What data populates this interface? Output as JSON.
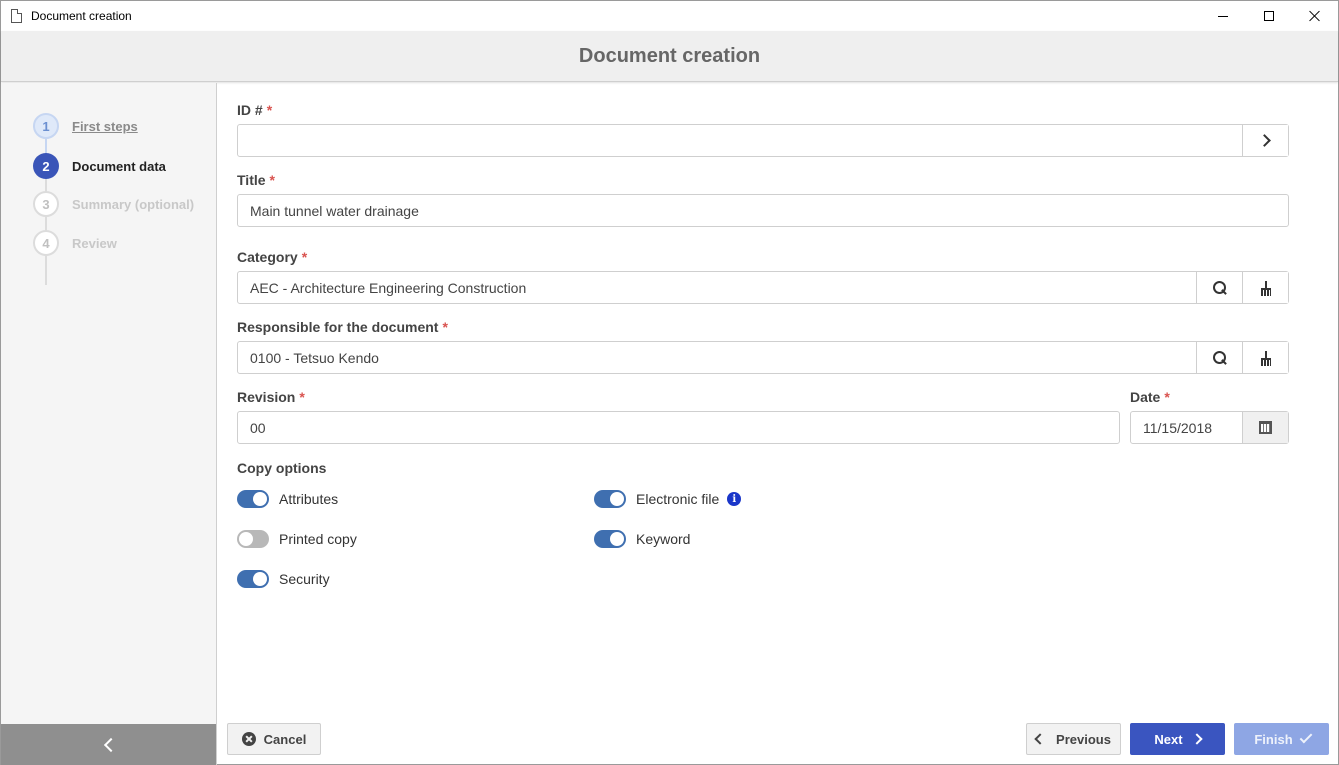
{
  "window": {
    "title": "Document creation"
  },
  "header": {
    "title": "Document creation"
  },
  "steps": [
    {
      "number": "1",
      "label": "First steps",
      "state": "done"
    },
    {
      "number": "2",
      "label": "Document data",
      "state": "active"
    },
    {
      "number": "3",
      "label": "Summary (optional)",
      "state": "todo"
    },
    {
      "number": "4",
      "label": "Review",
      "state": "todo"
    }
  ],
  "form": {
    "required_marker": "*",
    "id": {
      "label": "ID #",
      "value": ""
    },
    "title": {
      "label": "Title",
      "value": "Main tunnel water drainage"
    },
    "category": {
      "label": "Category",
      "value": "AEC - Architecture Engineering Construction"
    },
    "responsible": {
      "label": "Responsible for the document",
      "value": "0100 - Tetsuo Kendo"
    },
    "revision": {
      "label": "Revision",
      "value": "00"
    },
    "date": {
      "label": "Date",
      "value": "11/15/2018"
    }
  },
  "copy_options": {
    "title": "Copy options",
    "items": [
      {
        "label": "Attributes",
        "on": true
      },
      {
        "label": "Electronic file",
        "on": true,
        "info": true
      },
      {
        "label": "Printed copy",
        "on": false
      },
      {
        "label": "Keyword",
        "on": true
      },
      {
        "label": "Security",
        "on": true
      }
    ]
  },
  "footer": {
    "cancel": "Cancel",
    "previous": "Previous",
    "next": "Next",
    "finish": "Finish"
  },
  "colors": {
    "accent": "#3a55c0",
    "toggle_on": "#3f6fb0",
    "required": "#d9534f"
  }
}
